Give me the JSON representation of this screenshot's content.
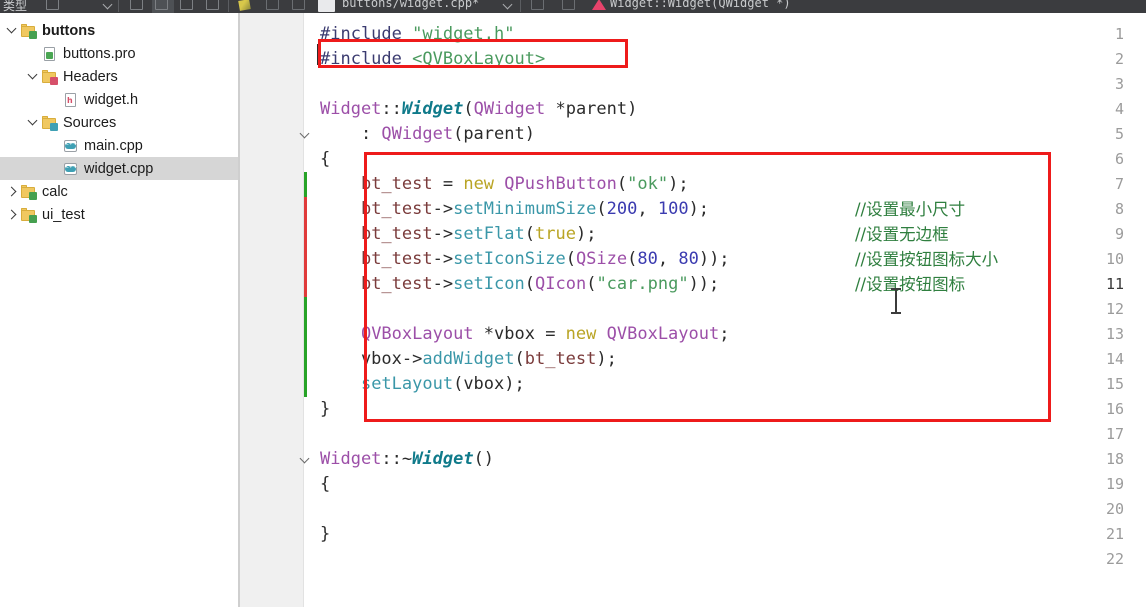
{
  "toolbar": {
    "left_label": "类型",
    "document_title": "buttons/widget.cpp*",
    "symbol_label": "Widget::Widget(QWidget *)",
    "icons": [
      "undo-icon",
      "link-icon",
      "split-icon",
      "save-icon",
      "pencil-icon",
      "slash-icon",
      "stop-icon",
      "build-icon",
      "chevron-icon",
      "bookmark-icon",
      "flag-icon"
    ]
  },
  "sidebar": {
    "items": [
      {
        "label": "buttons",
        "icon": "project-folder-icon",
        "indent": 0,
        "twisty": "down",
        "bold": true,
        "selected": false,
        "icon_kind": "folder",
        "badge": "green"
      },
      {
        "label": "buttons.pro",
        "icon": "pro-file-icon",
        "indent": 1,
        "twisty": "none",
        "bold": false,
        "selected": false,
        "icon_kind": "page",
        "badge": "green"
      },
      {
        "label": "Headers",
        "icon": "headers-folder-icon",
        "indent": 1,
        "twisty": "down",
        "bold": false,
        "selected": false,
        "icon_kind": "folder",
        "badge": "red"
      },
      {
        "label": "widget.h",
        "icon": "header-file-icon",
        "indent": 2,
        "twisty": "none",
        "bold": false,
        "selected": false,
        "icon_kind": "h",
        "badge": "red"
      },
      {
        "label": "Sources",
        "icon": "sources-folder-icon",
        "indent": 1,
        "twisty": "down",
        "bold": false,
        "selected": false,
        "icon_kind": "folder",
        "badge": "teal"
      },
      {
        "label": "main.cpp",
        "icon": "cpp-file-icon",
        "indent": 2,
        "twisty": "none",
        "bold": false,
        "selected": false,
        "icon_kind": "cpp",
        "badge": "teal"
      },
      {
        "label": "widget.cpp",
        "icon": "cpp-file-icon",
        "indent": 2,
        "twisty": "none",
        "bold": false,
        "selected": true,
        "icon_kind": "cpp",
        "badge": "teal"
      },
      {
        "label": "calc",
        "icon": "project-folder-icon",
        "indent": 0,
        "twisty": "right",
        "bold": false,
        "selected": false,
        "icon_kind": "folder",
        "badge": "green"
      },
      {
        "label": "ui_test",
        "icon": "project-folder-icon",
        "indent": 0,
        "twisty": "right",
        "bold": false,
        "selected": false,
        "icon_kind": "folder",
        "badge": "green"
      }
    ]
  },
  "editor": {
    "filename": "widget.cpp",
    "line_numbers": [
      "1",
      "2",
      "3",
      "4",
      "5",
      "6",
      "7",
      "8",
      "9",
      "10",
      "11",
      "12",
      "13",
      "14",
      "15",
      "16",
      "17",
      "18",
      "19",
      "20",
      "21",
      "22"
    ],
    "current_line": "11",
    "fold_lines": [
      "5",
      "18"
    ],
    "lines": [
      {
        "n": "1",
        "text": "#include \"widget.h\""
      },
      {
        "n": "2",
        "text": "#include <QVBoxLayout>"
      },
      {
        "n": "3",
        "text": ""
      },
      {
        "n": "4",
        "text": "Widget::Widget(QWidget *parent)"
      },
      {
        "n": "5",
        "text": "    : QWidget(parent)"
      },
      {
        "n": "6",
        "text": "{"
      },
      {
        "n": "7",
        "text": "    bt_test = new QPushButton(\"ok\");"
      },
      {
        "n": "8",
        "text": "    bt_test->setMinimumSize(200, 100);"
      },
      {
        "n": "9",
        "text": "    bt_test->setFlat(true);"
      },
      {
        "n": "10",
        "text": "    bt_test->setIconSize(QSize(80, 80));"
      },
      {
        "n": "11",
        "text": "    bt_test->setIcon(QIcon(\"car.png\"));"
      },
      {
        "n": "12",
        "text": ""
      },
      {
        "n": "13",
        "text": "    QVBoxLayout *vbox = new QVBoxLayout;"
      },
      {
        "n": "14",
        "text": "    vbox->addWidget(bt_test);"
      },
      {
        "n": "15",
        "text": "    setLayout(vbox);"
      },
      {
        "n": "16",
        "text": "}"
      },
      {
        "n": "17",
        "text": ""
      },
      {
        "n": "18",
        "text": "Widget::~Widget()"
      },
      {
        "n": "19",
        "text": "{"
      },
      {
        "n": "20",
        "text": ""
      },
      {
        "n": "21",
        "text": "}"
      },
      {
        "n": "22",
        "text": ""
      }
    ],
    "comments": [
      {
        "n": "8",
        "text": "//设置最小尺寸"
      },
      {
        "n": "9",
        "text": "//设置无边框"
      },
      {
        "n": "10",
        "text": "//设置按钮图标大小"
      },
      {
        "n": "11",
        "text": "//设置按钮图标"
      }
    ],
    "change_markers": [
      {
        "line": "7",
        "color": "green"
      },
      {
        "line": "8",
        "color": "red"
      },
      {
        "line": "9",
        "color": "red"
      },
      {
        "line": "10",
        "color": "red"
      },
      {
        "line": "11",
        "color": "red"
      },
      {
        "line": "12",
        "color": "green"
      },
      {
        "line": "13",
        "color": "green"
      },
      {
        "line": "14",
        "color": "green"
      },
      {
        "line": "15",
        "color": "green"
      }
    ]
  },
  "annotations": {
    "include_box_label": "highlight-include-qvboxlayout",
    "body_box_label": "highlight-constructor-body"
  },
  "colors": {
    "annotation_red": "#ee1b1b",
    "change_added": "#27a327",
    "change_modified": "#e03a3a",
    "comment_green": "#2f7f3f",
    "keyword_yellow": "#b9a424",
    "type_purple": "#9c4fa8",
    "function_teal": "#3a97a8",
    "string_green": "#4a9a5e",
    "number_blue": "#3b3bb0",
    "selection_gray": "#d6d6d6",
    "toolbar_dark": "#3b3c3f",
    "gutter_gray": "#f0f0f0"
  },
  "tokens": {
    "l1": [
      {
        "t": "#include ",
        "c": "pre"
      },
      {
        "t": "\"widget.h\"",
        "c": "str"
      }
    ],
    "l2": [
      {
        "t": "#include ",
        "c": "pre"
      },
      {
        "t": "<QVBoxLayout>",
        "c": "str"
      }
    ],
    "l4": [
      {
        "t": "Widget",
        "c": "typ"
      },
      {
        "t": "::",
        "c": "plain"
      },
      {
        "t": "Widget",
        "c": "ctor"
      },
      {
        "t": "(",
        "c": "plain"
      },
      {
        "t": "QWidget",
        "c": "typ"
      },
      {
        "t": " *parent)",
        "c": "plain"
      }
    ],
    "l5": [
      {
        "t": "    : ",
        "c": "plain"
      },
      {
        "t": "QWidget",
        "c": "typ"
      },
      {
        "t": "(parent)",
        "c": "plain"
      }
    ],
    "l6": [
      {
        "t": "{",
        "c": "plain"
      }
    ],
    "l7": [
      {
        "t": "    ",
        "c": "plain"
      },
      {
        "t": "bt_test",
        "c": "var"
      },
      {
        "t": " = ",
        "c": "plain"
      },
      {
        "t": "new",
        "c": "kw"
      },
      {
        "t": " ",
        "c": "plain"
      },
      {
        "t": "QPushButton",
        "c": "typ"
      },
      {
        "t": "(",
        "c": "plain"
      },
      {
        "t": "\"ok\"",
        "c": "str"
      },
      {
        "t": ");",
        "c": "plain"
      }
    ],
    "l8": [
      {
        "t": "    ",
        "c": "plain"
      },
      {
        "t": "bt_test",
        "c": "var"
      },
      {
        "t": "->",
        "c": "plain"
      },
      {
        "t": "setMinimumSize",
        "c": "fn"
      },
      {
        "t": "(",
        "c": "plain"
      },
      {
        "t": "200",
        "c": "num"
      },
      {
        "t": ", ",
        "c": "plain"
      },
      {
        "t": "100",
        "c": "num"
      },
      {
        "t": ");",
        "c": "plain"
      }
    ],
    "l9": [
      {
        "t": "    ",
        "c": "plain"
      },
      {
        "t": "bt_test",
        "c": "var"
      },
      {
        "t": "->",
        "c": "plain"
      },
      {
        "t": "setFlat",
        "c": "fn"
      },
      {
        "t": "(",
        "c": "plain"
      },
      {
        "t": "true",
        "c": "kw"
      },
      {
        "t": ");",
        "c": "plain"
      }
    ],
    "l10": [
      {
        "t": "    ",
        "c": "plain"
      },
      {
        "t": "bt_test",
        "c": "var"
      },
      {
        "t": "->",
        "c": "plain"
      },
      {
        "t": "setIconSize",
        "c": "fn"
      },
      {
        "t": "(",
        "c": "plain"
      },
      {
        "t": "QSize",
        "c": "typ"
      },
      {
        "t": "(",
        "c": "plain"
      },
      {
        "t": "80",
        "c": "num"
      },
      {
        "t": ", ",
        "c": "plain"
      },
      {
        "t": "80",
        "c": "num"
      },
      {
        "t": "));",
        "c": "plain"
      }
    ],
    "l11": [
      {
        "t": "    ",
        "c": "plain"
      },
      {
        "t": "bt_test",
        "c": "var"
      },
      {
        "t": "->",
        "c": "plain"
      },
      {
        "t": "setIcon",
        "c": "fn"
      },
      {
        "t": "(",
        "c": "plain"
      },
      {
        "t": "QIcon",
        "c": "typ"
      },
      {
        "t": "(",
        "c": "plain"
      },
      {
        "t": "\"car.png\"",
        "c": "str"
      },
      {
        "t": "));",
        "c": "plain"
      }
    ],
    "l13": [
      {
        "t": "    ",
        "c": "plain"
      },
      {
        "t": "QVBoxLayout",
        "c": "typ"
      },
      {
        "t": " *vbox = ",
        "c": "plain"
      },
      {
        "t": "new",
        "c": "kw"
      },
      {
        "t": " ",
        "c": "plain"
      },
      {
        "t": "QVBoxLayout",
        "c": "typ"
      },
      {
        "t": ";",
        "c": "plain"
      }
    ],
    "l14": [
      {
        "t": "    vbox->",
        "c": "plain"
      },
      {
        "t": "addWidget",
        "c": "fn"
      },
      {
        "t": "(",
        "c": "plain"
      },
      {
        "t": "bt_test",
        "c": "var"
      },
      {
        "t": ");",
        "c": "plain"
      }
    ],
    "l15": [
      {
        "t": "    ",
        "c": "plain"
      },
      {
        "t": "setLayout",
        "c": "fn"
      },
      {
        "t": "(vbox);",
        "c": "plain"
      }
    ],
    "l16": [
      {
        "t": "}",
        "c": "plain"
      }
    ],
    "l18": [
      {
        "t": "Widget",
        "c": "typ"
      },
      {
        "t": "::~",
        "c": "plain"
      },
      {
        "t": "Widget",
        "c": "ctor"
      },
      {
        "t": "()",
        "c": "plain"
      }
    ],
    "l19": [
      {
        "t": "{",
        "c": "plain"
      }
    ],
    "l21": [
      {
        "t": "}",
        "c": "plain"
      }
    ]
  }
}
